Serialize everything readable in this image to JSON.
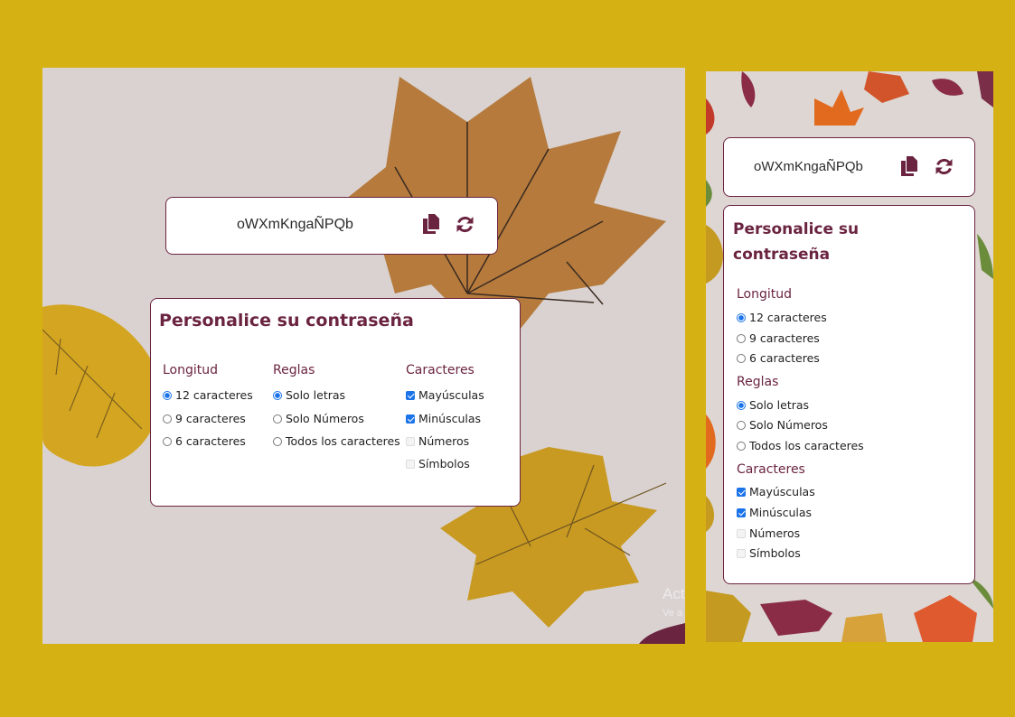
{
  "colors": {
    "page_background": "#d6b114",
    "accent": "#6b2440",
    "checkbox_checked": "#1a73e8"
  },
  "password": {
    "value": "oWXmKngaÑPQb",
    "copy_icon": "copy-icon",
    "refresh_icon": "refresh-icon"
  },
  "settings": {
    "title": "Personalice su contraseña",
    "longitud": {
      "heading": "Longitud",
      "options": [
        {
          "label": "12 caracteres",
          "selected": true
        },
        {
          "label": "9 caracteres",
          "selected": false
        },
        {
          "label": "6 caracteres",
          "selected": false
        }
      ]
    },
    "reglas": {
      "heading": "Reglas",
      "options": [
        {
          "label": "Solo letras",
          "selected": true
        },
        {
          "label": "Solo Números",
          "selected": false
        },
        {
          "label": "Todos los caracteres",
          "selected": false
        }
      ]
    },
    "caracteres": {
      "heading": "Caracteres",
      "options": [
        {
          "label": "Mayúsculas",
          "checked": true,
          "disabled": false
        },
        {
          "label": "Minúsculas",
          "checked": true,
          "disabled": false
        },
        {
          "label": "Números",
          "checked": false,
          "disabled": true
        },
        {
          "label": "Símbolos",
          "checked": false,
          "disabled": true
        }
      ]
    }
  },
  "watermark": {
    "line1": "Acti",
    "line2": "Ve a"
  }
}
